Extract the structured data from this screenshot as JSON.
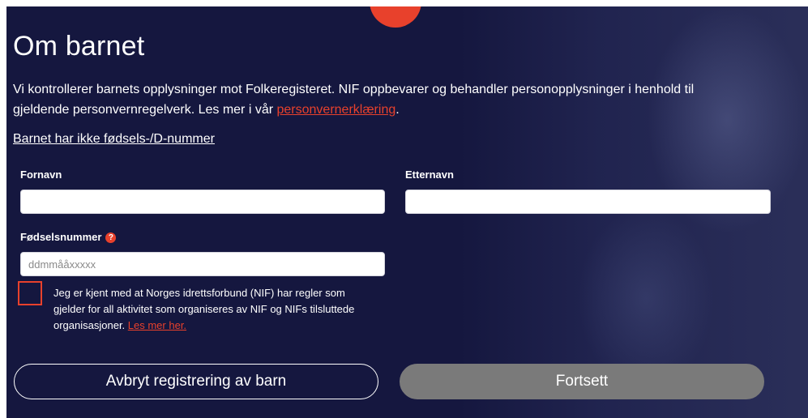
{
  "heading": "Om barnet",
  "intro": {
    "text": "Vi kontrollerer barnets opplysninger mot Folkeregisteret. NIF oppbevarer og behandler personopplysninger i henhold til gjeldende personvernregelverk. Les mer i vår ",
    "link": "personvernerklæring",
    "suffix": "."
  },
  "no_id_link": "Barnet har ikke fødsels-/D-nummer",
  "fields": {
    "first_name": {
      "label": "Fornavn",
      "value": "",
      "placeholder": ""
    },
    "last_name": {
      "label": "Etternavn",
      "value": "",
      "placeholder": ""
    },
    "birth_number": {
      "label": "Fødselsnummer",
      "value": "",
      "placeholder": "ddmmååxxxxx",
      "help_icon": "question-icon"
    }
  },
  "consent": {
    "checked": false,
    "text": "Jeg er kjent med at Norges idrettsforbund (NIF) har regler som gjelder for all aktivitet som organiseres av NIF og NIFs tilsluttede organisasjoner. ",
    "link": "Les mer her."
  },
  "buttons": {
    "cancel": "Avbryt registrering av barn",
    "continue": "Fortsett"
  },
  "colors": {
    "background": "#15173f",
    "accent": "#e8412c",
    "disabled_button": "#7a7a7a"
  }
}
